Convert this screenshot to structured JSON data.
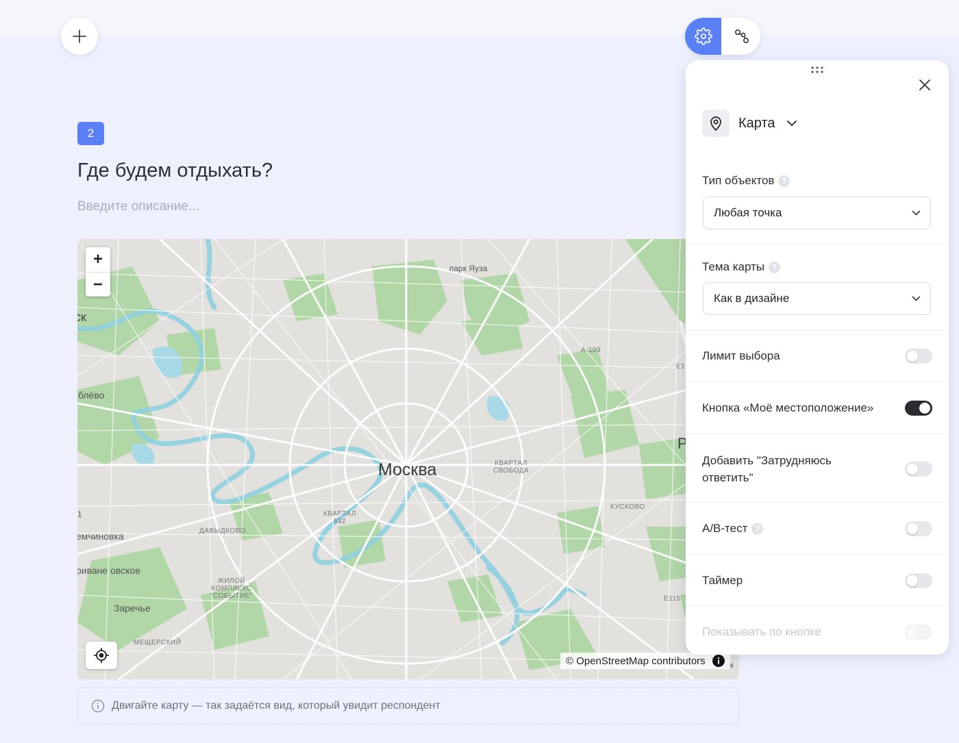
{
  "toolbar": {
    "add_icon": "plus-icon",
    "settings_icon": "gear-icon",
    "logic_icon": "branch-icon",
    "accent": "#5b7ff5"
  },
  "question": {
    "number": "2",
    "title": "Где будем отдыхать?",
    "description_placeholder": "Введите описание..."
  },
  "map": {
    "labels": {
      "park": "парк Яуза",
      "city": "Москва",
      "left_k": "ск",
      "oblevo": "блёво",
      "nemchinovka": "емчиновка",
      "ivanovskoe": "риване овское",
      "zarechye": "Заречье",
      "davydkovo": "ДАВЫДКОВО",
      "kvartal532": "КВАРТАЛ 532",
      "kvartal_svoboda": "КВАРТАЛ СВОБОДА",
      "kuskovo": "КУСКОВО",
      "zhk": "ЖИЛОЙ КОМПЛЕКС \"СОБЫТИЕ\"",
      "meshchersky": "МЕЩЕРСКИЙ",
      "a103": "A-103",
      "e115": "E115",
      "e1": "E1",
      "right_r": "Р",
      "ik": "ик",
      "one": "1"
    },
    "zoom_in": "+",
    "zoom_out": "−",
    "locate_icon": "crosshair-icon",
    "attribution": "© OpenStreetMap contributors",
    "info_icon": "info-icon"
  },
  "hint": {
    "icon": "info-icon",
    "text": "Двигайте карту — так задаётся вид, который увидит респондент"
  },
  "panel": {
    "drag_icon": "drag-handle-icon",
    "close_icon": "close-icon",
    "widget_icon": "map-pin-icon",
    "widget_name": "Карта",
    "object_type_label": "Тип объектов",
    "object_type_value": "Любая точка",
    "theme_label": "Тема карты",
    "theme_value": "Как в дизайне",
    "toggles": [
      {
        "label": "Лимит выбора",
        "on": false
      },
      {
        "label": "Кнопка «Моё местоположение»",
        "on": true
      },
      {
        "label": "Добавить \"Затрудняюсь ответить\"",
        "on": false
      },
      {
        "label": "А/В-тест",
        "on": false
      },
      {
        "label": "Таймер",
        "on": false
      },
      {
        "label": "Показывать по кнопке",
        "on": false
      }
    ],
    "help": "?"
  }
}
